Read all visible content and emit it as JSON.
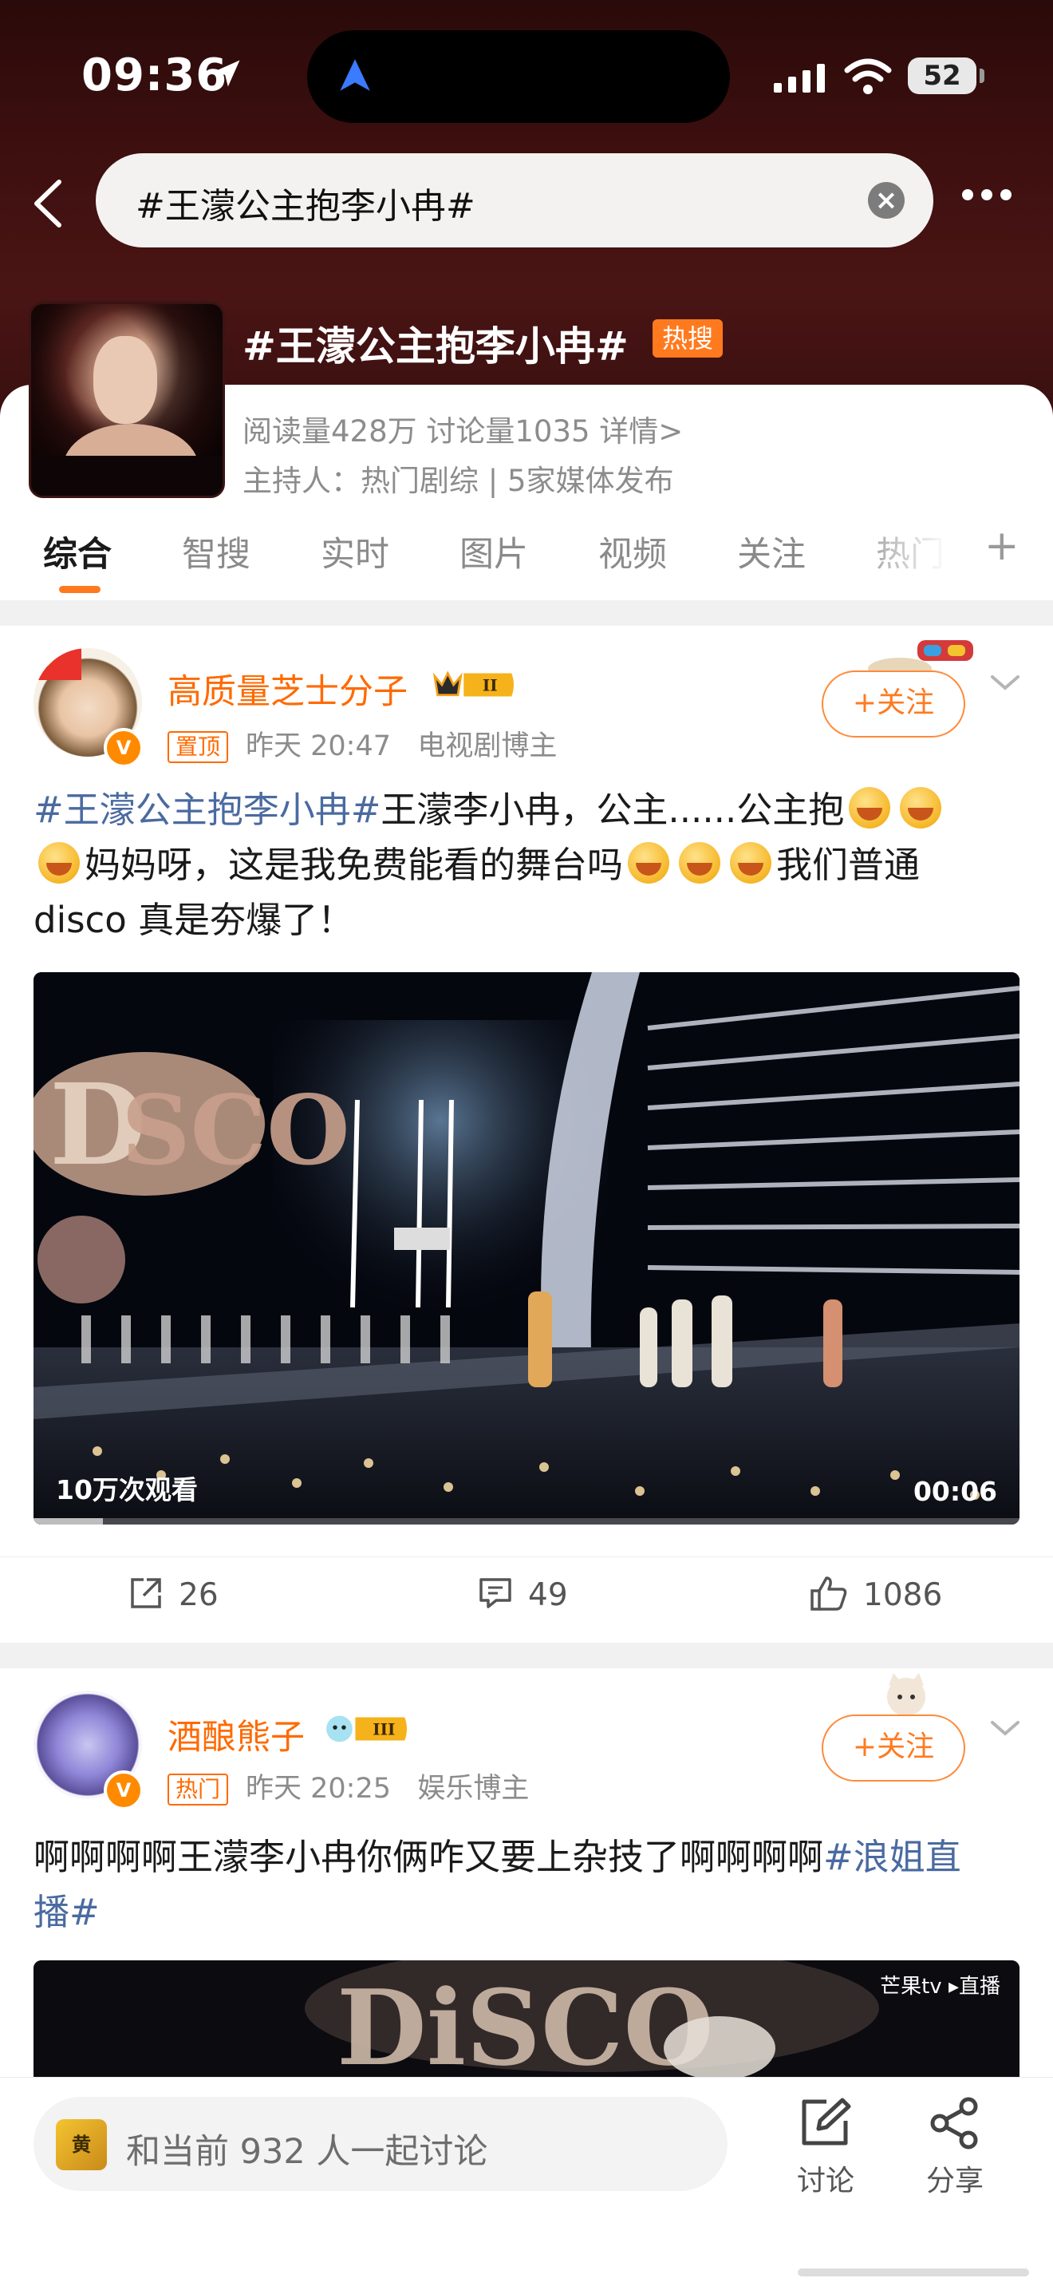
{
  "status": {
    "time": "09:36",
    "battery": "52"
  },
  "search": {
    "query": "#王濛公主抱李小冉#",
    "clear_glyph": "×"
  },
  "topic": {
    "title": "#王濛公主抱李小冉#",
    "badge": "热搜",
    "stats": "阅读量428万  讨论量1035  详情>",
    "host": "主持人：热门剧综 | 5家媒体发布"
  },
  "tabs": [
    "综合",
    "智搜",
    "实时",
    "图片",
    "视频",
    "关注",
    "热门"
  ],
  "tab_plus": "+",
  "posts": [
    {
      "author": "高质量芝士分子",
      "level": "II",
      "tag": "置顶",
      "time": "昨天 20:47",
      "source": "电视剧博主",
      "follow": "+关注",
      "text": {
        "hashtag": "#王濛公主抱李小冉#",
        "line1": "王濛李小冉，公主......公主抱",
        "line2": "妈妈呀，这是我免费能看的舞台吗",
        "line2b": "我们普通",
        "line3": "disco 真是夯爆了！"
      },
      "video": {
        "views": "10万次观看",
        "duration": "00:06",
        "progress": 0.07
      },
      "actions": {
        "repost": "26",
        "comment": "49",
        "like": "1086"
      }
    },
    {
      "author": "酒酿熊子",
      "level": "III",
      "tag": "热门",
      "time": "昨天 20:25",
      "source": "娱乐博主",
      "follow": "+关注",
      "text": {
        "body": "啊啊啊啊王濛李小冉你俩咋又要上杂技了啊啊啊啊",
        "hashtag1": "#浪姐直",
        "hashtag2": "播#"
      },
      "video_watermark": "芒果tv ▸直播"
    }
  ],
  "bottom": {
    "avatar_text": "黄",
    "placeholder": "和当前 932 人一起讨论",
    "discuss": "讨论",
    "share": "分享"
  },
  "colors": {
    "accent": "#ff7a1f",
    "hashtag": "#4a6aa0",
    "header": "#3d0f0f"
  }
}
